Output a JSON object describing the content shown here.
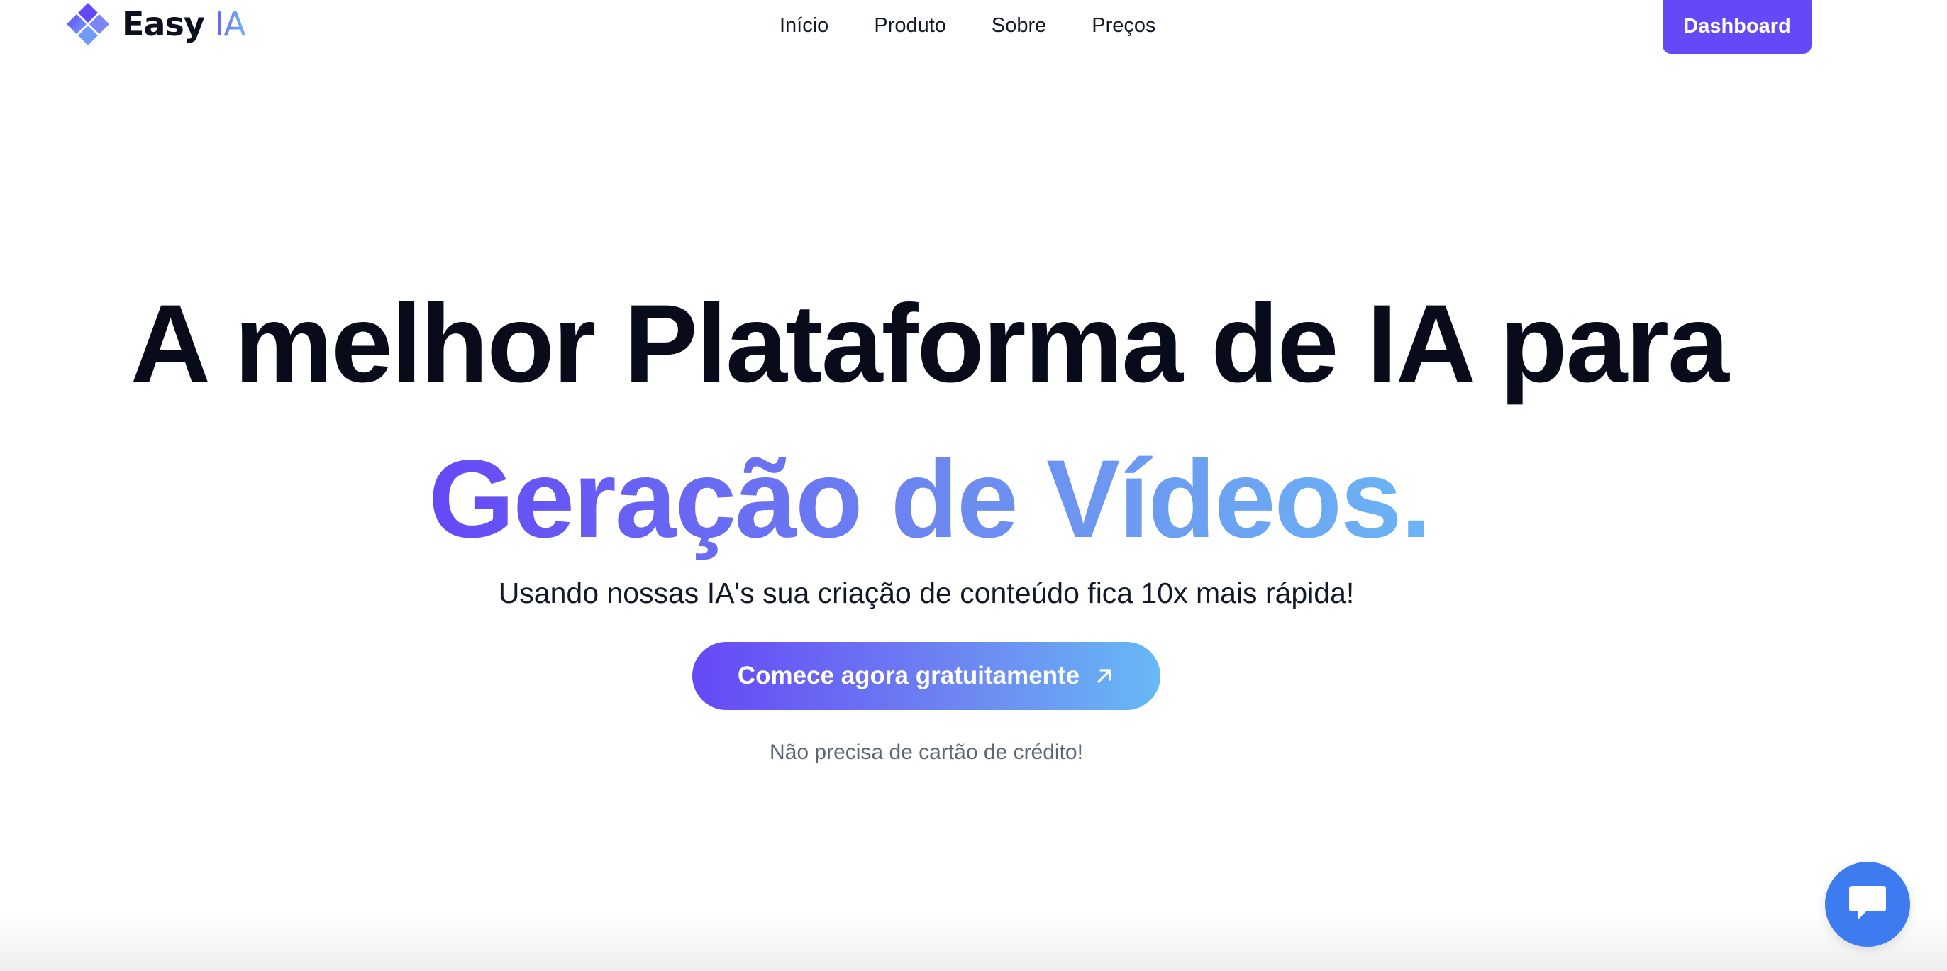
{
  "brand": {
    "name_main": "Easy",
    "name_accent": "IA",
    "icon": "stacked-diamonds-logo-icon",
    "gradient_start": "#6548f6",
    "gradient_end": "#6bb4f5"
  },
  "nav": {
    "items": [
      {
        "label": "Início"
      },
      {
        "label": "Produto"
      },
      {
        "label": "Sobre"
      },
      {
        "label": "Preços"
      }
    ]
  },
  "header": {
    "dashboard_label": "Dashboard",
    "dashboard_color": "#6548f6"
  },
  "hero": {
    "title_line1": "A melhor Plataforma de IA para",
    "title_line2": "Geração de Vídeos.",
    "subtitle": "Usando nossas IA's sua criação de conteúdo fica 10x mais rápida!",
    "cta_label": "Comece agora gratuitamente",
    "cta_icon": "arrow-up-right-icon",
    "note": "Não precisa de cartão de crédito!"
  },
  "chat": {
    "icon": "chat-bubble-icon",
    "color": "#3d7cf0"
  }
}
